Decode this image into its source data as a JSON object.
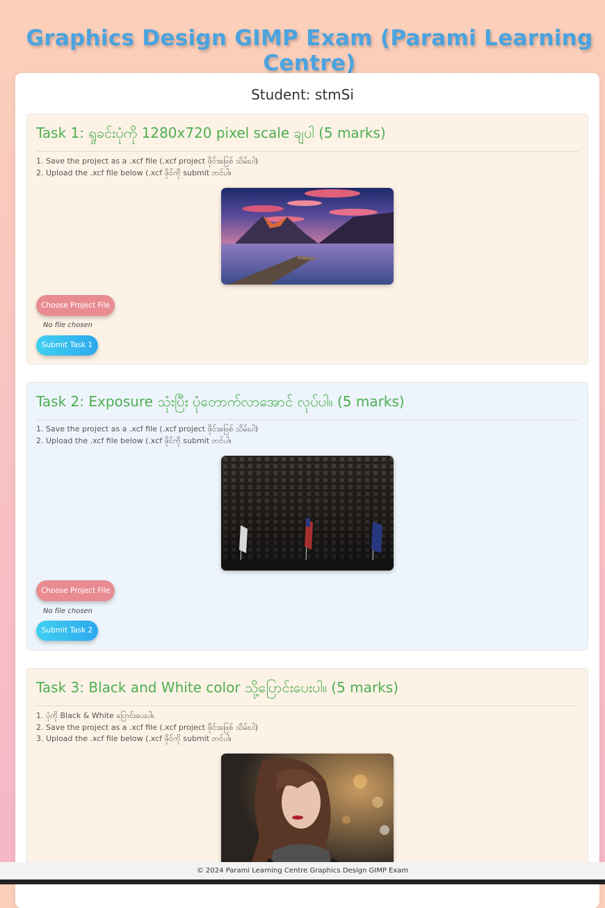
{
  "header": {
    "title": "Graphics Design GIMP Exam (Parami Learning Centre)"
  },
  "student": {
    "label": "Student: stmSi"
  },
  "tasks": [
    {
      "title": "Task 1: ရှုခင်းပုံကို 1280x720 pixel scale ချပါ (5 marks)",
      "instructions": [
        "1. Save the project as a .xcf file (.xcf project ဖိုင်အဖြစ် သိမ်းပါ)",
        "2. Upload the .xcf file below (.xcf ဖိုင်ကို submit တင်ပါ။"
      ],
      "image": "mountain-lake-landscape",
      "choose_label": "Choose Project File",
      "file_status": "No file chosen",
      "submit_label": "Submit Task 1"
    },
    {
      "title": "Task 2: Exposure သုံးပြီး ပုံတောက်လာအောင် လုပ်ပါ။ (5 marks)",
      "instructions": [
        "1. Save the project as a .xcf file (.xcf project ဖိုင်အဖြစ် သိမ်းပါ)",
        "2. Upload the .xcf file below (.xcf ဖိုင်ကို submit တင်ပါ။"
      ],
      "image": "dark-building-flags",
      "choose_label": "Choose Project File",
      "file_status": "No file chosen",
      "submit_label": "Submit Task 2"
    },
    {
      "title": "Task 3: Black and White color သို့ပြောင်းပေးပါ။ (5 marks)",
      "instructions": [
        "1. ပုံကို Black & White ပြောင်းပေးပါ။",
        "2. Save the project as a .xcf file (.xcf project ဖိုင်အဖြစ် သိမ်းပါ)",
        "3. Upload the .xcf file below (.xcf ဖိုင်ကို submit တင်ပါ။"
      ],
      "image": "woman-portrait"
    }
  ],
  "footer": {
    "text": "© 2024 Parami Learning Centre Graphics Design GIMP Exam"
  },
  "colors": {
    "title": "#4aa3df",
    "task_title": "#4caf50",
    "choose_button": "#e98c92",
    "submit_button": "#2ea8ee"
  }
}
